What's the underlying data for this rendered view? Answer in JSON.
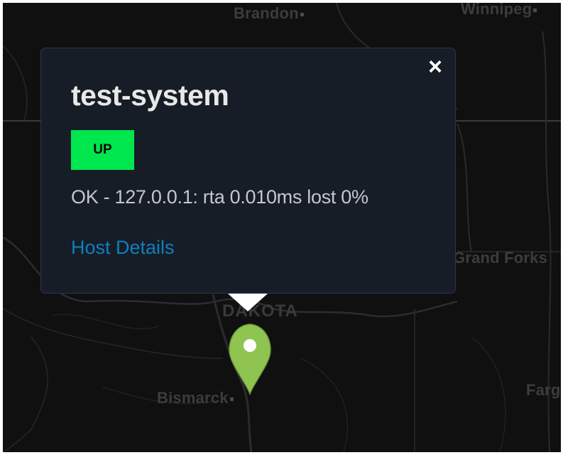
{
  "map": {
    "cities": [
      "Brandon",
      "Winnipeg",
      "Grand Forks",
      "Bismarck",
      "Farg"
    ],
    "state_label": "DAKOTA",
    "marker_icon": "map-pin-icon",
    "marker_color": "#8fc450"
  },
  "popup": {
    "close_label": "×",
    "close_icon": "close-icon",
    "host_name": "test-system",
    "status": "UP",
    "status_color": "#00e64d",
    "status_output": "OK - 127.0.0.1: rta 0.010ms lost 0%",
    "details_link": "Host Details",
    "link_color": "#0e7fbf"
  }
}
